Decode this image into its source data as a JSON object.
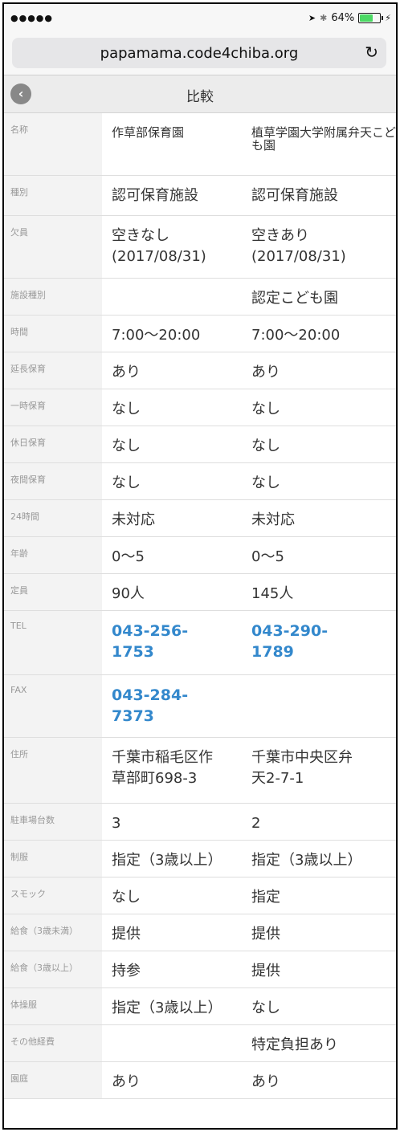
{
  "status": {
    "signal": "●●●●●",
    "battery": "64%",
    "battery_level": 0.64,
    "location_arrow": "➤",
    "bluetooth": "✱"
  },
  "browser": {
    "url": "papamama.code4chiba.org",
    "reload_icon": "↻"
  },
  "header": {
    "back_icon": "‹",
    "title": "比較"
  },
  "rows": [
    {
      "label": "名称",
      "a": "作草部保育園",
      "b": "植草学園大学附属弁天こども園"
    },
    {
      "label": "種別",
      "a": "認可保育施設",
      "b": "認可保育施設"
    },
    {
      "label": "欠員",
      "a": "空きなし\n(2017/08/31)",
      "b": "空きあり\n(2017/08/31)"
    },
    {
      "label": "施設種別",
      "a": "",
      "b": "認定こども園"
    },
    {
      "label": "時間",
      "a": "7:00〜20:00",
      "b": "7:00〜20:00"
    },
    {
      "label": "延長保育",
      "a": "あり",
      "b": "あり"
    },
    {
      "label": "一時保育",
      "a": "なし",
      "b": "なし"
    },
    {
      "label": "休日保育",
      "a": "なし",
      "b": "なし"
    },
    {
      "label": "夜間保育",
      "a": "なし",
      "b": "なし"
    },
    {
      "label": "24時間",
      "a": "未対応",
      "b": "未対応"
    },
    {
      "label": "年齢",
      "a": "0〜5",
      "b": "0〜5"
    },
    {
      "label": "定員",
      "a": "90人",
      "b": "145人"
    },
    {
      "label": "TEL",
      "a": "043-256-\n1753",
      "b": "043-290-\n1789"
    },
    {
      "label": "FAX",
      "a": "043-284-\n7373",
      "b": ""
    },
    {
      "label": "住所",
      "a": "千葉市稲毛区作\n草部町698-3",
      "b": "千葉市中央区弁\n天2-7-1"
    },
    {
      "label": "駐車場台数",
      "a": "3",
      "b": "2"
    },
    {
      "label": "制服",
      "a": "指定（3歳以上）",
      "b": "指定（3歳以上）"
    },
    {
      "label": "スモック",
      "a": "なし",
      "b": "指定"
    },
    {
      "label": "給食（3歳未満）",
      "a": "提供",
      "b": "提供"
    },
    {
      "label": "給食（3歳以上）",
      "a": "持参",
      "b": "提供"
    },
    {
      "label": "体操服",
      "a": "指定（3歳以上）",
      "b": "なし"
    },
    {
      "label": "その他経費",
      "a": "",
      "b": "特定負担あり"
    },
    {
      "label": "園庭",
      "a": "あり",
      "b": "あり"
    }
  ]
}
